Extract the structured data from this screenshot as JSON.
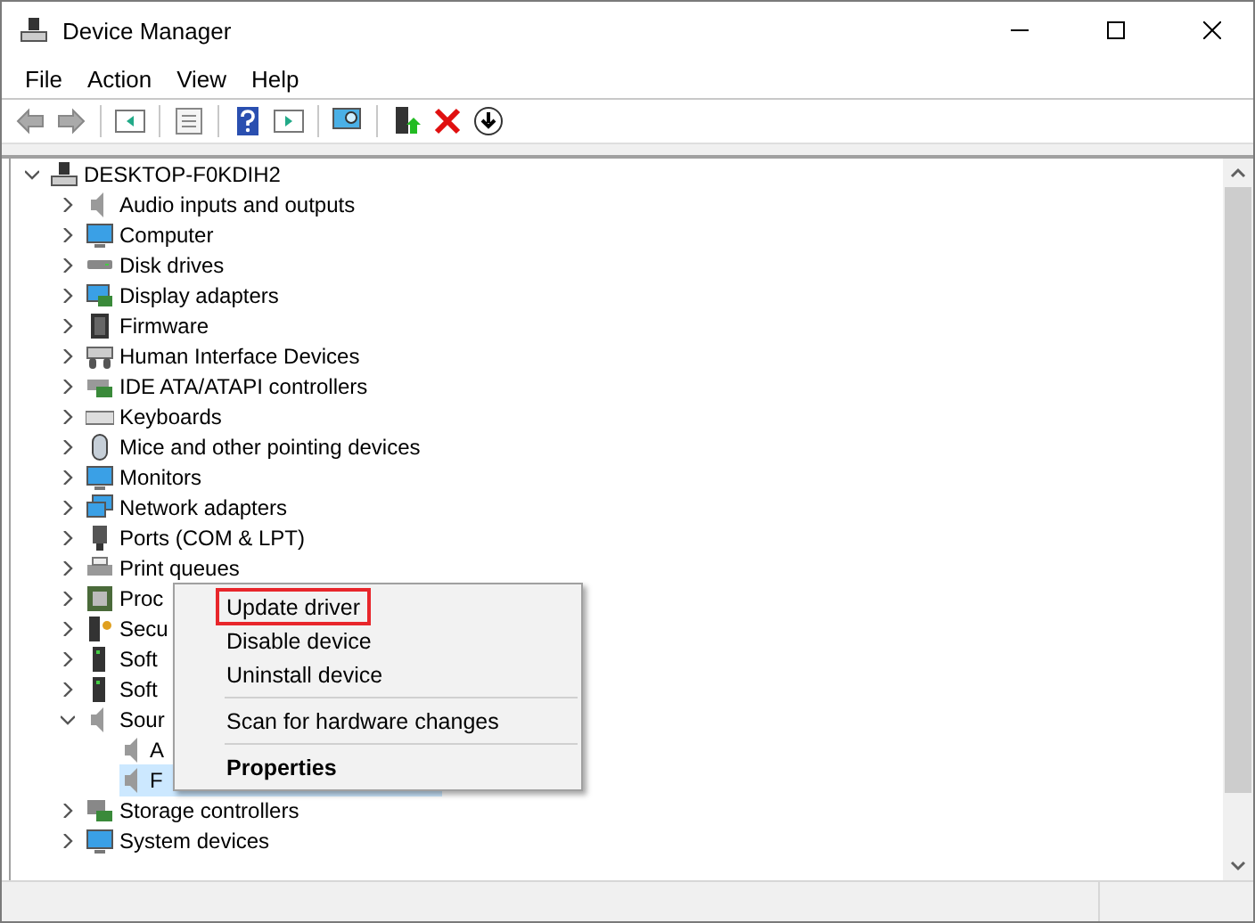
{
  "window": {
    "title": "Device Manager"
  },
  "menu_bar": [
    "File",
    "Action",
    "View",
    "Help"
  ],
  "tree": {
    "label": "DESKTOP-F0KDIH2",
    "expanded": true,
    "children": [
      {
        "label": "Audio inputs and outputs",
        "expanded": false
      },
      {
        "label": "Computer",
        "expanded": false
      },
      {
        "label": "Disk drives",
        "expanded": false
      },
      {
        "label": "Display adapters",
        "expanded": false
      },
      {
        "label": "Firmware",
        "expanded": false
      },
      {
        "label": "Human Interface Devices",
        "expanded": false
      },
      {
        "label": "IDE ATA/ATAPI controllers",
        "expanded": false
      },
      {
        "label": "Keyboards",
        "expanded": false
      },
      {
        "label": "Mice and other pointing devices",
        "expanded": false
      },
      {
        "label": "Monitors",
        "expanded": false
      },
      {
        "label": "Network adapters",
        "expanded": false
      },
      {
        "label": "Ports (COM & LPT)",
        "expanded": false
      },
      {
        "label": "Print queues",
        "expanded": false
      },
      {
        "label": "Proc",
        "expanded": false
      },
      {
        "label": "Secu",
        "expanded": false
      },
      {
        "label": "Soft",
        "expanded": false
      },
      {
        "label": "Soft",
        "expanded": false
      },
      {
        "label": "Sour",
        "expanded": true,
        "children": [
          {
            "label": "A",
            "selected": false
          },
          {
            "label": "F",
            "selected": true
          }
        ]
      },
      {
        "label": "Storage controllers",
        "expanded": false
      },
      {
        "label": "System devices",
        "expanded": false
      }
    ]
  },
  "context_menu": [
    {
      "kind": "item",
      "label": "Update driver",
      "highlighted": true,
      "default": false
    },
    {
      "kind": "item",
      "label": "Disable device",
      "highlighted": false,
      "default": false
    },
    {
      "kind": "item",
      "label": "Uninstall device",
      "highlighted": false,
      "default": false
    },
    {
      "kind": "separator"
    },
    {
      "kind": "item",
      "label": "Scan for hardware changes",
      "highlighted": false,
      "default": false
    },
    {
      "kind": "separator"
    },
    {
      "kind": "item",
      "label": "Properties",
      "highlighted": false,
      "default": true
    }
  ]
}
